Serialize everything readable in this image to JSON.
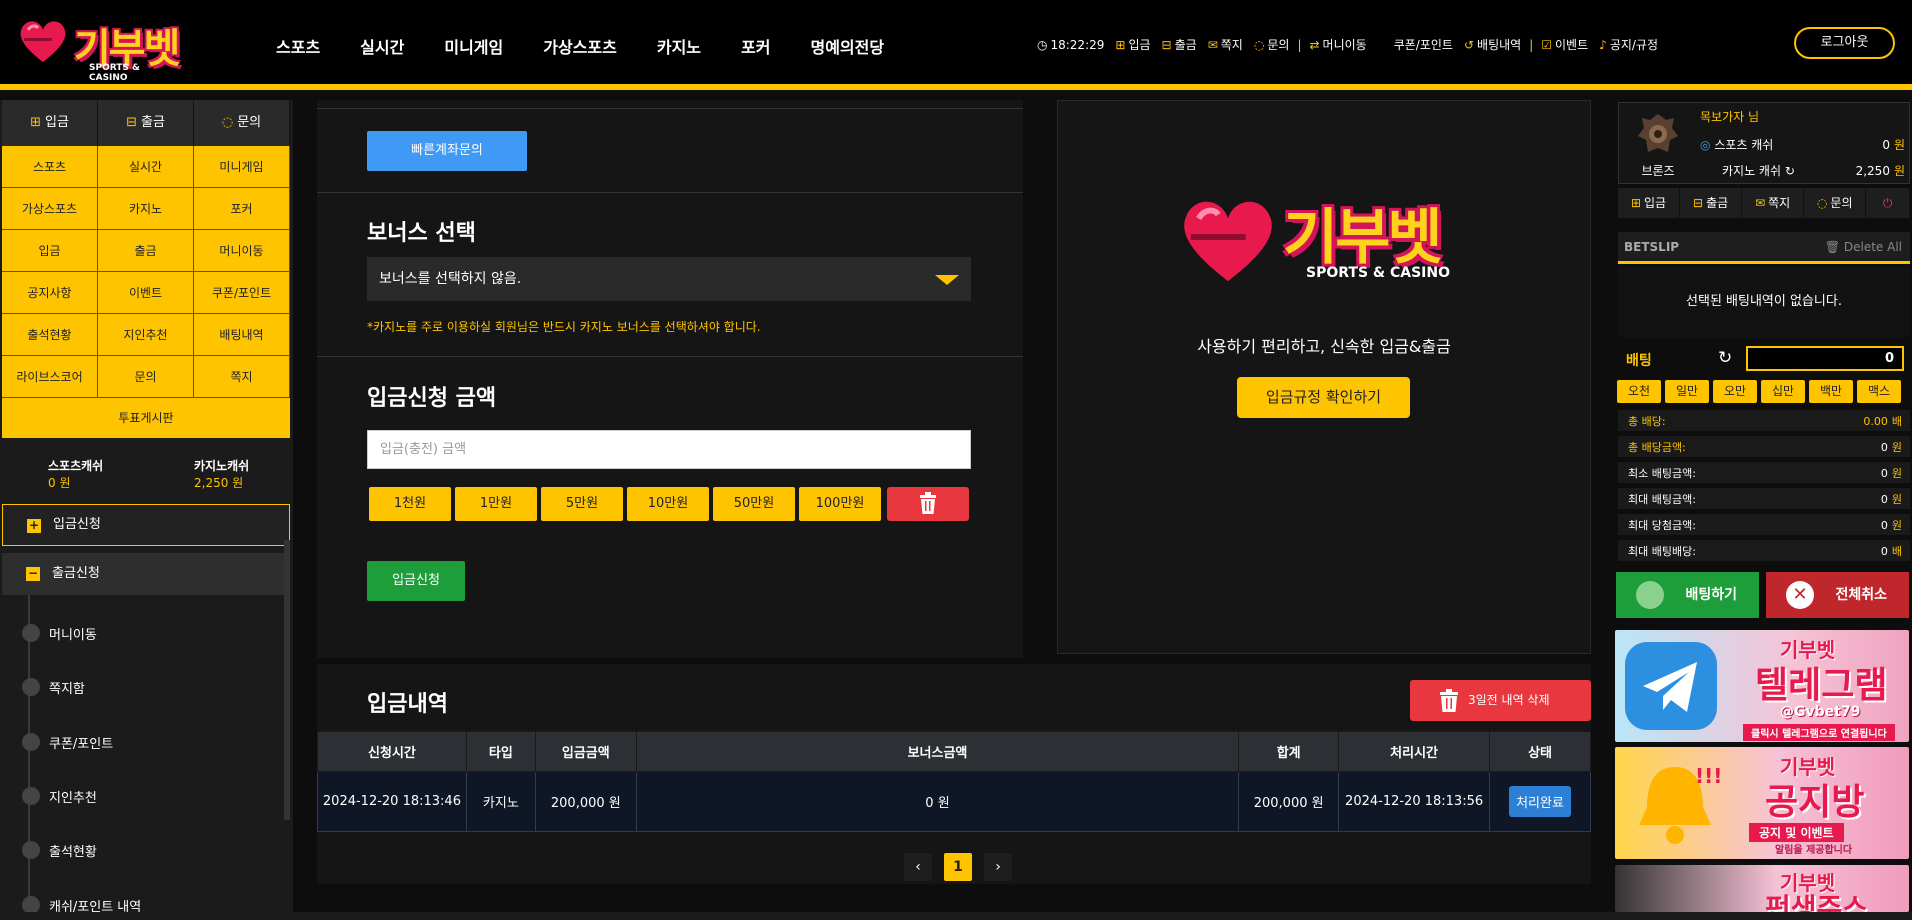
{
  "header": {
    "logo": {
      "brand": "기부벳",
      "sub": "SPORTS & CASINO"
    },
    "nav": [
      "스포츠",
      "실시간",
      "미니게임",
      "가상스포츠",
      "카지노",
      "포커",
      "명예의전당"
    ],
    "util": {
      "clock": "18:22:29",
      "items_a": [
        "입금",
        "출금",
        "쪽지",
        "문의"
      ],
      "items_b": [
        "머니이동",
        "쿠폰/포인트",
        "배팅내역"
      ],
      "items_c": [
        "이벤트",
        "공지/규정"
      ]
    },
    "logout": "로그아웃"
  },
  "left": {
    "quick": [
      "입금",
      "출금",
      "문의"
    ],
    "grid": [
      "스포츠",
      "실시간",
      "미니게임",
      "가상스포츠",
      "카지노",
      "포커",
      "입금",
      "출금",
      "머니이동",
      "공지사항",
      "이벤트",
      "쿠폰/포인트",
      "출석현황",
      "지인추천",
      "배팅내역",
      "라이브스코어",
      "문의",
      "쪽지"
    ],
    "vote": "투표게시판",
    "sports_cash_label": "스포츠캐쉬",
    "sports_cash": "0 원",
    "casino_cash_label": "카지노캐쉬",
    "casino_cash": "2,250 원",
    "menu_deposit": "입금신청",
    "menu_withdraw": "출금신청",
    "subs": [
      "머니이동",
      "쪽지함",
      "쿠폰/포인트",
      "지인추천",
      "출석현황",
      "캐쉬/포인트 내역"
    ]
  },
  "form": {
    "quick_account": "빠른계좌문의",
    "bonus_title": "보너스 선택",
    "bonus_value": "보너스를 선택하지 않음.",
    "bonus_note": "*카지노를 주로 이용하실 회원님은 반드시 카지노 보너스를 선택하셔야 합니다.",
    "amount_title": "입금신청 금액",
    "amount_placeholder": "입금(충전) 금액",
    "amounts": [
      "1천원",
      "1만원",
      "5만원",
      "10만원",
      "50만원",
      "100만원"
    ],
    "submit": "입금신청"
  },
  "info": {
    "brand": "기부벳",
    "sub": "SPORTS & CASINO",
    "tagline": "사용하기 편리하고, 신속한 입금&출금",
    "rule_button": "입금규정 확인하기"
  },
  "history": {
    "title": "입금내역",
    "delete_button": "3일전 내역 삭제",
    "columns": [
      "신청시간",
      "타입",
      "입금금액",
      "보너스금액",
      "합계",
      "처리시간",
      "상태"
    ],
    "rows": [
      {
        "time": "2024-12-20 18:13:46",
        "type": "카지노",
        "amount": "200,000 원",
        "bonus": "0 원",
        "total": "200,000 원",
        "done": "2024-12-20 18:13:56",
        "status": "처리완료"
      }
    ],
    "pager": {
      "prev": "‹",
      "page": "1",
      "next": "›"
    }
  },
  "right": {
    "rank": "브론즈",
    "user": "목보가자 님",
    "sports_cash_label": "스포츠 캐쉬",
    "sports_cash_num": "0",
    "casino_cash_label": "카지노 캐쉬",
    "casino_cash_num": "2,250",
    "won": "원",
    "buttons": [
      "입금",
      "출금",
      "쪽지",
      "문의"
    ],
    "betslip": "BETSLIP",
    "delete_all": "Delete All",
    "empty": "선택된 배팅내역이 없습니다.",
    "bet_label": "배팅",
    "bet_value": "0",
    "chips": [
      "오천",
      "일만",
      "오만",
      "십만",
      "백만",
      "맥스"
    ],
    "stats": [
      {
        "label": "총 배당:",
        "value": "0.00",
        "unit": "배"
      },
      {
        "label": "총 배당금액:",
        "value": "0",
        "unit": "원"
      },
      {
        "label": "최소 배팅금액:",
        "value": "0",
        "unit": "원"
      },
      {
        "label": "최대 배팅금액:",
        "value": "0",
        "unit": "원"
      },
      {
        "label": "최대 당첨금액:",
        "value": "0",
        "unit": "원"
      },
      {
        "label": "최대 배팅배당:",
        "value": "0",
        "unit": "배"
      }
    ],
    "bet_button": "배팅하기",
    "cancel_button": "전체취소",
    "banners": [
      {
        "brand": "기부벳",
        "title": "텔레그램",
        "handle": "@Gvbet79",
        "caption": "클릭시 텔레그램으로 연결됩니다"
      },
      {
        "brand": "기부벳",
        "title": "공지방",
        "handle": "공지 및 이벤트",
        "caption": "알림을 제공합니다"
      },
      {
        "brand": "기부벳",
        "title": "펀생주스",
        "handle": "",
        "caption": ""
      }
    ]
  },
  "colors": {
    "accent": "#ffc400",
    "brand_pink": "#d4145a",
    "blue": "#3f9af5",
    "green": "#1e9e3a",
    "red": "#e8373e"
  }
}
